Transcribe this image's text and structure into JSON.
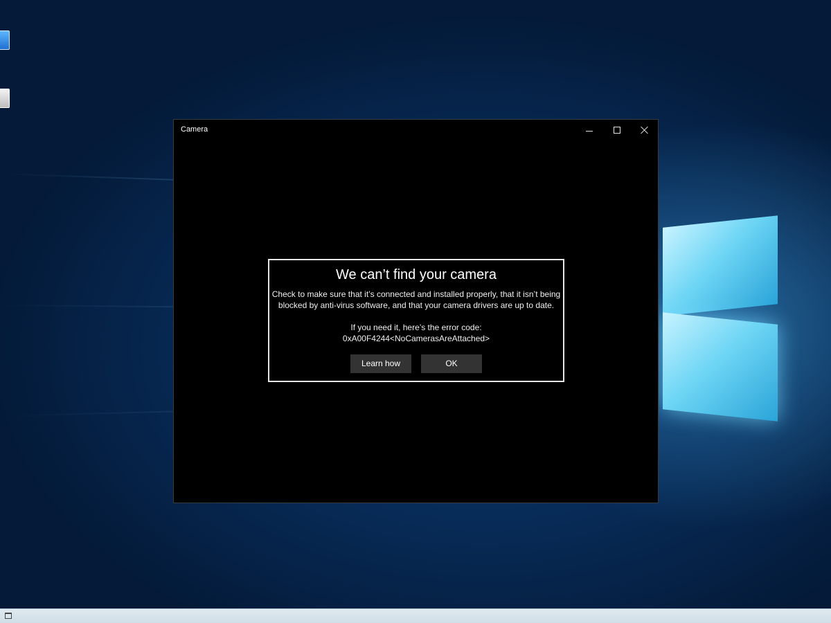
{
  "window": {
    "title": "Camera",
    "minimize_icon": "minimize-icon",
    "maximize_icon": "maximize-icon",
    "close_icon": "close-icon"
  },
  "dialog": {
    "title": "We can’t find your camera",
    "body_line1": "Check to make sure that it’s connected and installed properly, that it isn’t being",
    "body_line2": "blocked by anti-virus software, and that your camera drivers are up to date.",
    "code_label": "If you need it, here’s the error code:",
    "code_value": "0xA00F4244<NoCamerasAreAttached>",
    "learn_button": "Learn how",
    "ok_button": "OK"
  },
  "taskbar": {
    "task_view_icon": "task-view-icon"
  },
  "colors": {
    "window_bg": "#000000",
    "button_bg": "#333333",
    "dialog_border": "#e6e6e6",
    "desktop_bg": "#072a55",
    "taskbar_bg": "#dfe9f0"
  }
}
